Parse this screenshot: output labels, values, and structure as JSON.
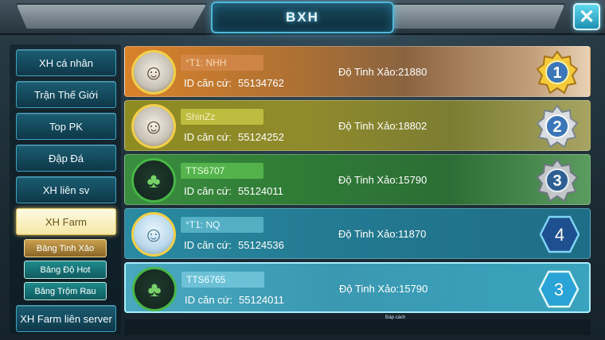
{
  "header": {
    "title": "BXH",
    "close_icon": "close-icon"
  },
  "sidebar": {
    "items": [
      {
        "label": "XH cá nhân"
      },
      {
        "label": "Trận Thế Giới"
      },
      {
        "label": "Top PK"
      },
      {
        "label": "Đập Đá"
      },
      {
        "label": "XH liên sv"
      },
      {
        "label": "XH Farm",
        "active": true
      },
      {
        "label": "XH Farm liên server"
      }
    ],
    "subitems": [
      {
        "label": "Bảng Tinh Xảo",
        "active": true
      },
      {
        "label": "Bảng Độ Hot"
      },
      {
        "label": "Bảng Trộm Rau"
      }
    ]
  },
  "ranking": [
    {
      "name": "°T1: NHH",
      "id_label": "ID căn cứ:",
      "id": "55134762",
      "score_label": "Độ Tinh Xảo:",
      "score": "21880",
      "rank": "1",
      "rank_style": "gold-medal"
    },
    {
      "name": "ShinZz",
      "id_label": "ID căn cứ:",
      "id": "55124252",
      "score_label": "Độ Tinh Xảo:",
      "score": "18802",
      "rank": "2",
      "rank_style": "silver-medal"
    },
    {
      "name": "TTS6707",
      "id_label": "ID căn cứ:",
      "id": "55124011",
      "score_label": "Độ Tinh Xảo:",
      "score": "15790",
      "rank": "3",
      "rank_style": "bronze-medal"
    },
    {
      "name": "°T1: NQ",
      "id_label": "ID căn cứ:",
      "id": "55124536",
      "score_label": "Độ Tinh Xảo:",
      "score": "11870",
      "rank": "4",
      "rank_style": "hex-badge"
    },
    {
      "name": "TTS6765",
      "id_label": "ID căn cứ:",
      "id": "55124011",
      "score_label": "Độ Tinh Xảo:",
      "score": "15790",
      "rank": "3",
      "rank_style": "hex-badge-highlight"
    }
  ],
  "footer": {
    "watermark": "Đáp cách"
  },
  "colors": {
    "title_glow": "#5fd0ff",
    "active_tab": "#f4e7a5",
    "gold": "#f2cf47"
  }
}
